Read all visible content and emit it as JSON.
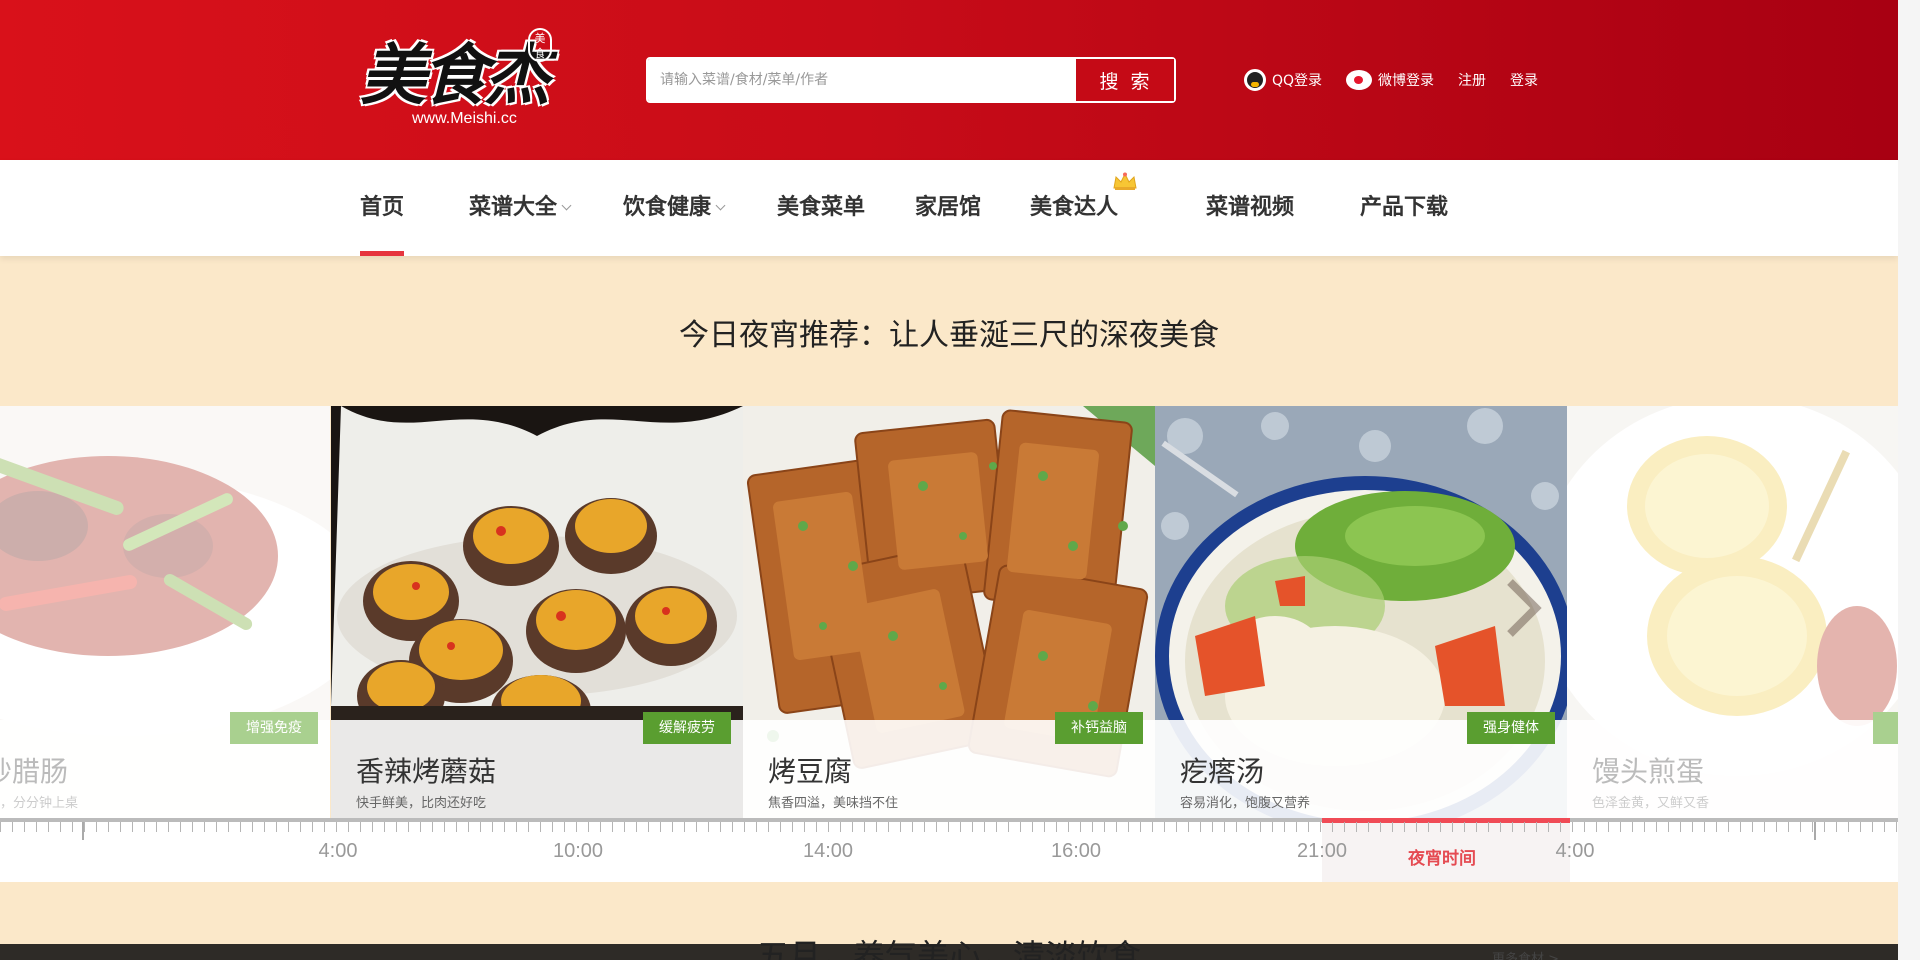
{
  "header": {
    "logo_text": "美食杰",
    "logo_seal": "美食",
    "logo_url": "www.Meishi.cc",
    "search": {
      "placeholder": "请输入菜谱/食材/菜单/作者",
      "button_label": "搜 索"
    },
    "links": [
      {
        "label": "QQ登录",
        "icon": "qq-icon"
      },
      {
        "label": "微博登录",
        "icon": "weibo-icon"
      },
      {
        "label": "注册"
      },
      {
        "label": "登录"
      }
    ]
  },
  "nav": {
    "items": [
      {
        "label": "首页",
        "active": true
      },
      {
        "label": "菜谱大全",
        "dropdown": true
      },
      {
        "label": "饮食健康",
        "dropdown": true
      },
      {
        "label": "美食菜单"
      },
      {
        "label": "家居馆"
      },
      {
        "label": "美食达人",
        "badge_icon": "crown-icon"
      },
      {
        "label": "菜谱视频"
      },
      {
        "label": "产品下载"
      }
    ]
  },
  "section_title": "今日夜宵推荐：让人垂涎三尺的深夜美食",
  "carousel": {
    "cards": [
      {
        "name": "炒腊肠",
        "desc": "，分分钟上桌",
        "tag": "增强免疫",
        "dim": true
      },
      {
        "name": "香辣烤蘑菇",
        "desc": "快手鲜美，比肉还好吃",
        "tag": "缓解疲劳"
      },
      {
        "name": "烤豆腐",
        "desc": "焦香四溢，美味挡不住",
        "tag": "补钙益脑"
      },
      {
        "name": "疙瘩汤",
        "desc": "容易消化，饱腹又营养",
        "tag": "强身健体"
      },
      {
        "name": "馒头煎蛋",
        "desc": "色泽金黄，又鲜又香",
        "tag": "",
        "dim": true
      }
    ]
  },
  "timeline": {
    "labels": [
      "4:00",
      "10:00",
      "14:00",
      "16:00",
      "21:00",
      "4:00"
    ],
    "highlight_label": "夜宵时间"
  },
  "bottom": {
    "title": "五月，养气美心，清淡饮食",
    "more": "更多食材 >"
  },
  "colors": {
    "header_red": "#c80c18",
    "accent_red": "#e6353f",
    "tag_green": "#5a9e30",
    "page_bg": "#fbe8c9"
  }
}
